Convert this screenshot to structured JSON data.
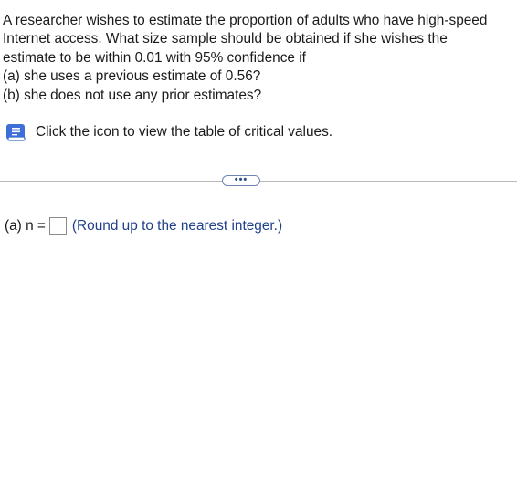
{
  "question": {
    "lines": [
      "A researcher wishes to estimate the proportion of adults who have high-speed",
      "Internet access. What size sample should be obtained if she wishes the",
      "estimate to be within 0.01 with 95% confidence if",
      "(a) she uses a previous estimate of 0.56?",
      "(b) she does not use any prior estimates?"
    ]
  },
  "critical_values": {
    "icon": "book-icon",
    "text": "Click the icon to view the table of critical values."
  },
  "expand": {
    "label": "•••"
  },
  "answer": {
    "label": "(a) n =",
    "value": "",
    "hint": "(Round up to the nearest integer.)"
  },
  "colors": {
    "hint_text": "#1f3f8a",
    "icon_blue": "#3d6fd6",
    "divider": "#b9b9b9"
  }
}
